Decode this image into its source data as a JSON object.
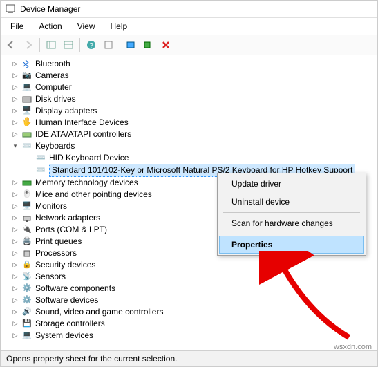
{
  "window": {
    "title": "Device Manager"
  },
  "menu": {
    "file": "File",
    "action": "Action",
    "view": "View",
    "help": "Help"
  },
  "tree": {
    "bluetooth": "Bluetooth",
    "cameras": "Cameras",
    "computer": "Computer",
    "disk": "Disk drives",
    "display": "Display adapters",
    "hid": "Human Interface Devices",
    "ide": "IDE ATA/ATAPI controllers",
    "keyboards": "Keyboards",
    "kb_hid": "HID Keyboard Device",
    "kb_std": "Standard 101/102-Key or Microsoft Natural PS/2 Keyboard for HP Hotkey Support",
    "memory": "Memory technology devices",
    "mice": "Mice and other pointing devices",
    "monitors": "Monitors",
    "network": "Network adapters",
    "ports": "Ports (COM & LPT)",
    "printq": "Print queues",
    "processors": "Processors",
    "security": "Security devices",
    "sensors": "Sensors",
    "softcomp": "Software components",
    "softdev": "Software devices",
    "sound": "Sound, video and game controllers",
    "storage": "Storage controllers",
    "system": "System devices"
  },
  "context": {
    "update": "Update driver",
    "uninstall": "Uninstall device",
    "scan": "Scan for hardware changes",
    "properties": "Properties"
  },
  "status": "Opens property sheet for the current selection.",
  "watermark": "wsxdn.com"
}
